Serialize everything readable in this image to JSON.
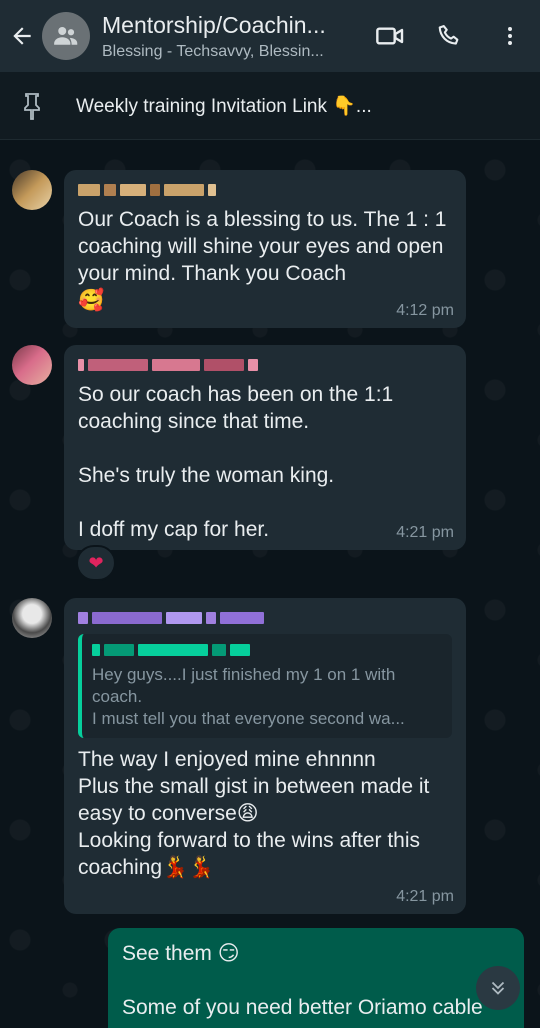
{
  "header": {
    "title": "Mentorship/Coachin...",
    "subtitle": "Blessing - Techsavvy, Blessin...",
    "icons": [
      "back-arrow-icon",
      "group-avatar-icon",
      "video-call-icon",
      "voice-call-icon",
      "more-options-icon"
    ]
  },
  "pinned": {
    "text": "Weekly training Invitation Link 👇..."
  },
  "messages": [
    {
      "text": "Our Coach is a blessing to us. The 1 : 1 coaching will shine your eyes and open your mind. Thank you Coach",
      "emoji": "🥰",
      "time": "4:12 pm"
    },
    {
      "text": "So our coach has been on the 1:1 coaching since that time.\n\nShe's truly the woman king.\n\nI doff my cap for her.",
      "time": "4:21 pm",
      "reaction": "❤"
    },
    {
      "quote": "Hey guys....I just finished my 1 on 1 with coach.\nI must tell you that everyone second wa...",
      "text": "The way I enjoyed mine ehnnnn\nPlus the small gist in between made it easy to converse😩\nLooking forward to the wins after this coaching💃💃",
      "time": "4:21 pm"
    },
    {
      "text": "See them 😏\n\nSome of you need better Oriamo cable"
    }
  ]
}
